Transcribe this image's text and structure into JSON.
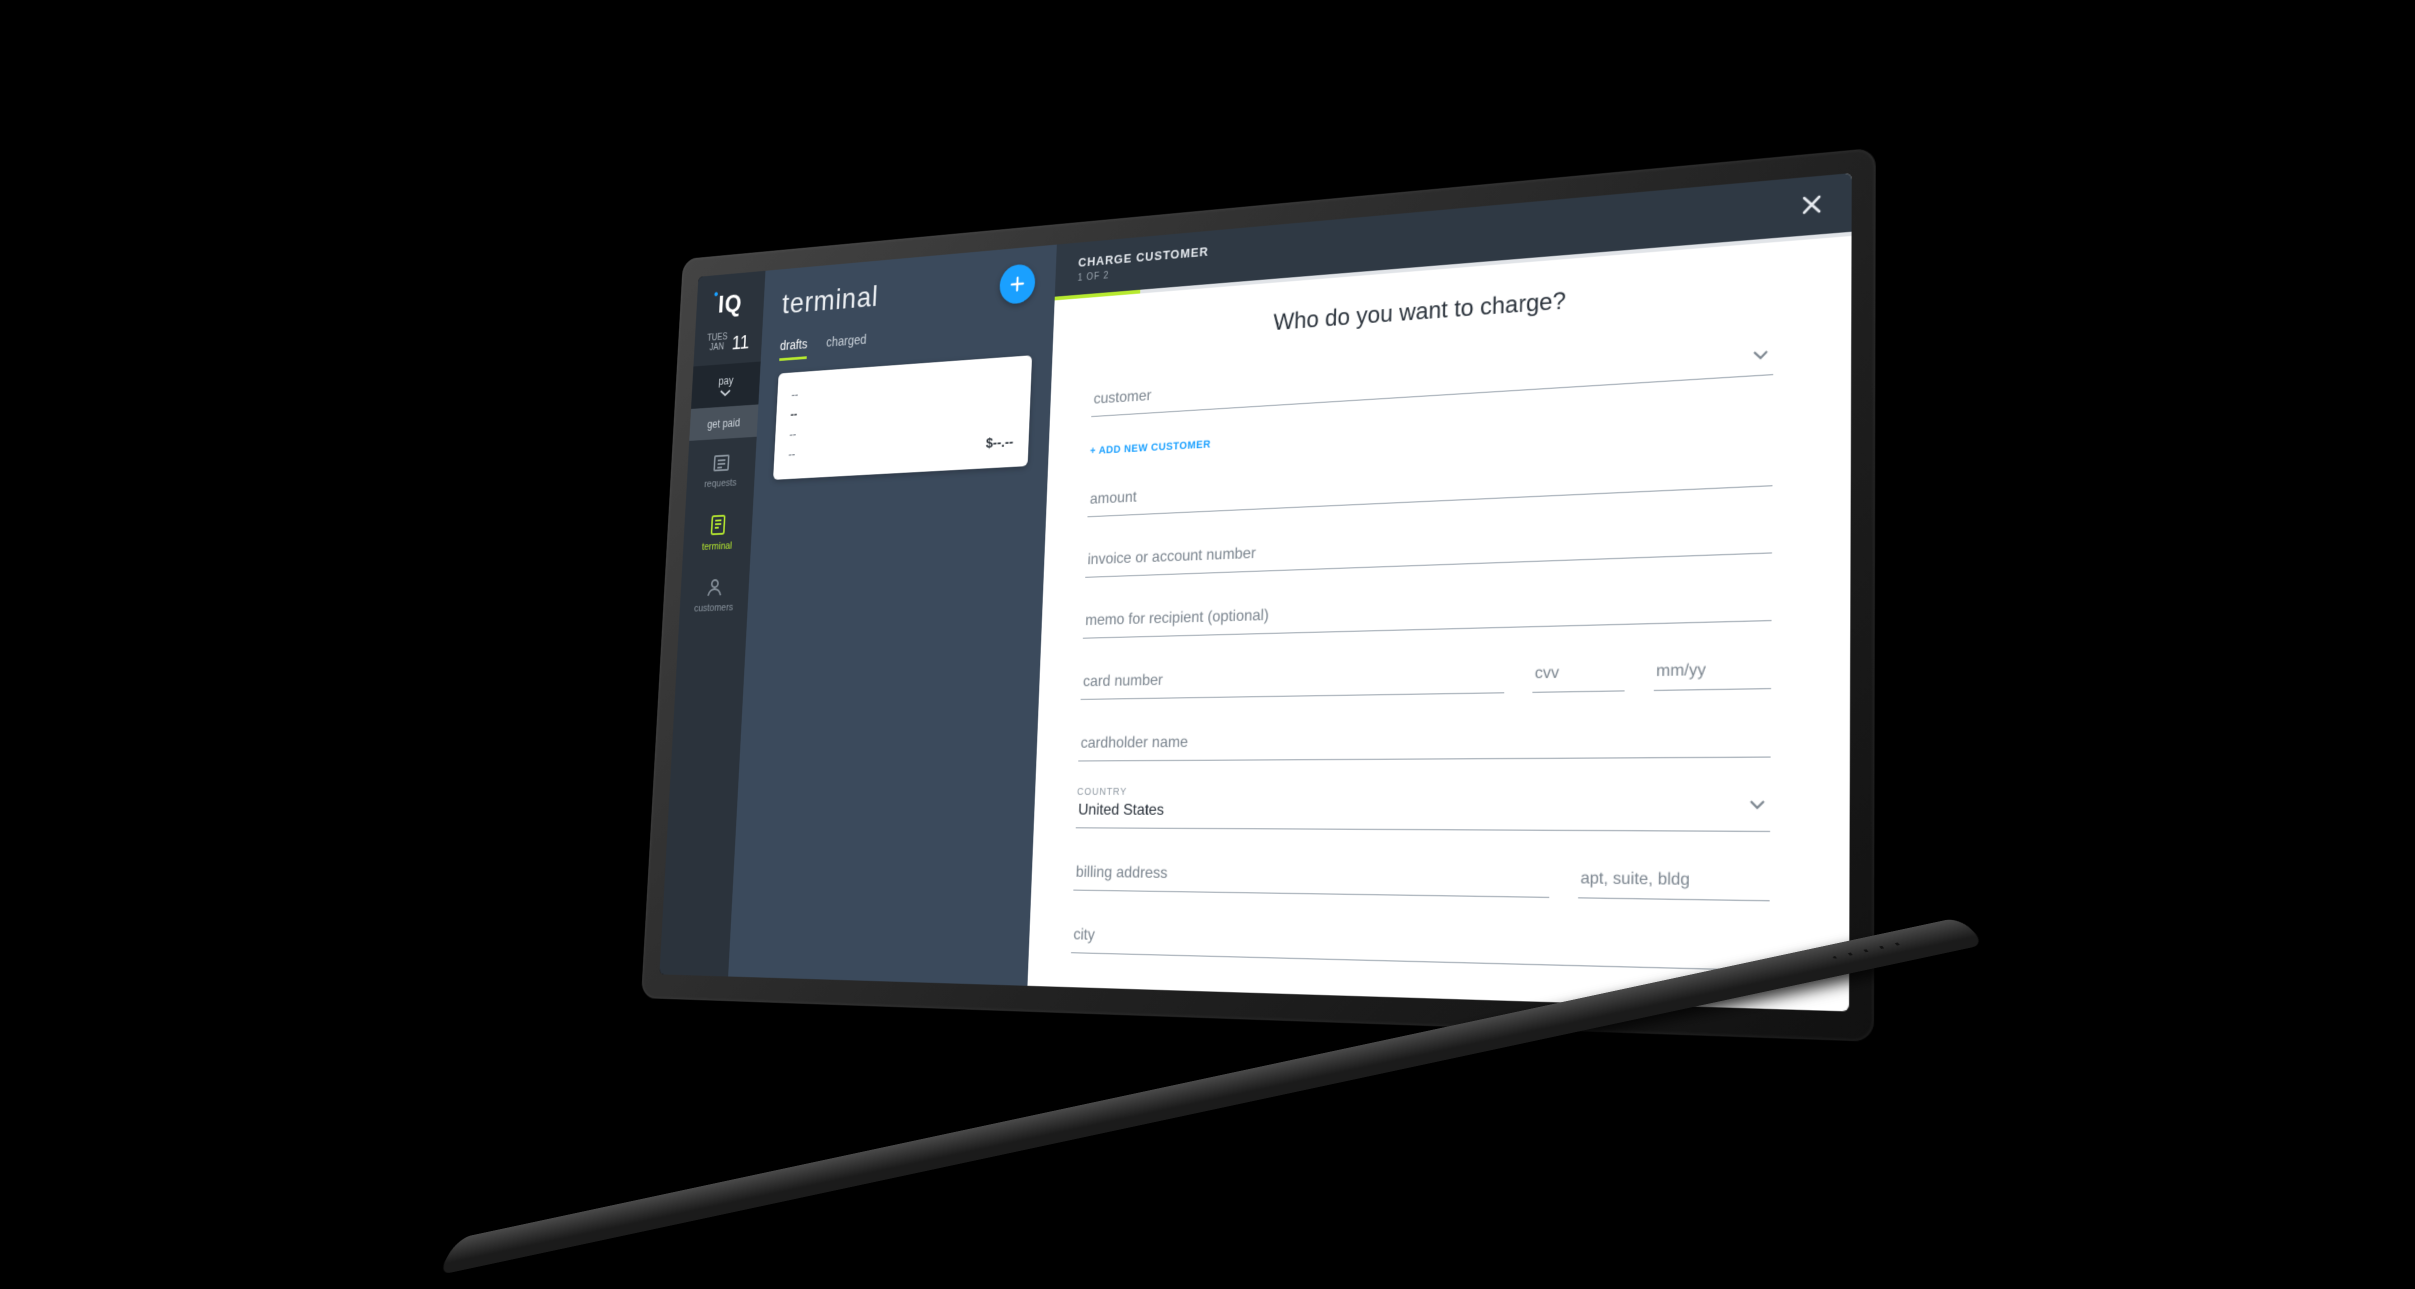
{
  "sidebar": {
    "logo_text": "IQ",
    "date": {
      "dow_line1": "TUES",
      "dow_line2": "JAN",
      "day": "11"
    },
    "pay_label": "pay",
    "getpaid_label": "get paid",
    "items": [
      {
        "key": "requests",
        "label": "requests"
      },
      {
        "key": "terminal",
        "label": "terminal"
      },
      {
        "key": "customers",
        "label": "customers"
      }
    ]
  },
  "terminal": {
    "title": "terminal",
    "tabs": {
      "drafts": "drafts",
      "charged": "charged"
    },
    "draft_card": {
      "line1": "--",
      "line2": "--",
      "line3": "--",
      "line4": "--",
      "amount": "$--.--"
    }
  },
  "panel": {
    "title": "CHARGE CUSTOMER",
    "step": "1 OF 2",
    "heading": "Who do you want to charge?",
    "add_customer": "+ ADD NEW CUSTOMER",
    "country_label": "COUNTRY",
    "country_value": "United States",
    "placeholders": {
      "customer": "customer",
      "amount": "amount",
      "invoice": "invoice or account number",
      "memo": "memo for recipient (optional)",
      "card": "card number",
      "cvv": "cvv",
      "exp": "mm/yy",
      "cardholder": "cardholder name",
      "addr": "billing address",
      "unit": "apt, suite, bldg",
      "city": "city"
    }
  }
}
